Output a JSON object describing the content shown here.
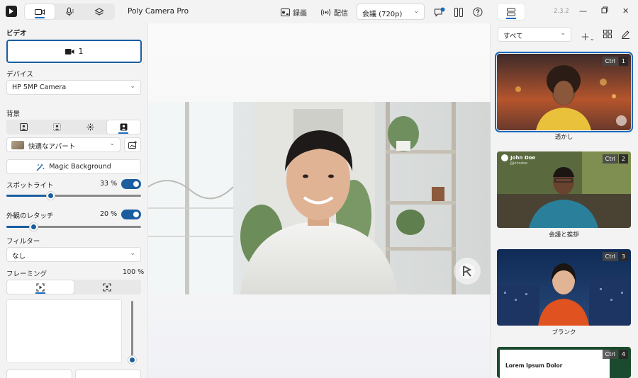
{
  "app": {
    "title": "Poly Camera Pro",
    "version": "2.3.2"
  },
  "toolbar": {
    "record_label": "録画",
    "stream_label": "配信",
    "mode_value": "会議 (720p)"
  },
  "left": {
    "video_heading": "ビデオ",
    "camera_button_label": "1",
    "device_heading": "デバイス",
    "device_value": "HP 5MP Camera",
    "background_heading": "背景",
    "background_value": "快適なアパート",
    "magic_label": "Magic Background",
    "spotlight_label": "スポットライト",
    "spotlight_value": "33 %",
    "spotlight_level": 0.33,
    "appearance_label": "外観のレタッチ",
    "appearance_value": "20 %",
    "appearance_level": 0.2,
    "filter_heading": "フィルター",
    "filter_value": "なし",
    "framing_heading": "フレーミング",
    "framing_value": "100 %"
  },
  "right": {
    "filter_value": "すべて",
    "scenes": [
      {
        "label": "透かし",
        "ctrl": "Ctrl",
        "key": "1"
      },
      {
        "label": "会議と挨拶",
        "ctrl": "Ctrl",
        "key": "2",
        "overlay_name": "John Doe",
        "overlay_sub": "@johndoe"
      },
      {
        "label": "ブランク",
        "ctrl": "Ctrl",
        "key": "3"
      },
      {
        "label": "",
        "ctrl": "Ctrl",
        "key": "4",
        "overlay_title": "Lorem Ipsum Dolor"
      }
    ]
  },
  "colors": {
    "accent": "#1a5ea0"
  }
}
